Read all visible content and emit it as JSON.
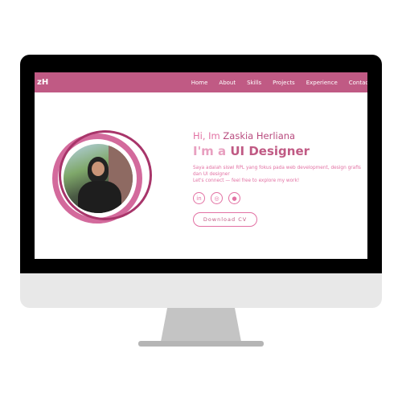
{
  "nav": {
    "logo": "zH",
    "links": [
      "Home",
      "About",
      "Skills",
      "Projects",
      "Experience",
      "Contact"
    ]
  },
  "hero": {
    "greeting_prefix": "Hi, Im ",
    "name": "Zaskia Herliana",
    "title_prefix": "I'm a ",
    "role": "UI Designer",
    "description": "Saya adalah siswi RPL yang fokus pada web development, design grafis dan UI designer",
    "cta_text": "Let's connect — feel free to explore my work!",
    "download_label": "Download CV"
  },
  "social": [
    "linkedin-icon",
    "instagram-icon",
    "github-icon"
  ],
  "colors": {
    "accent": "#c05a84",
    "pink": "#e271a3"
  }
}
